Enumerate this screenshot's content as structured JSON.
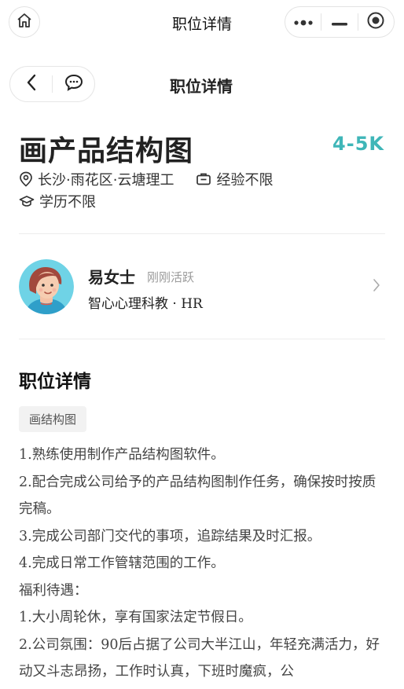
{
  "window": {
    "title": "职位详情"
  },
  "page": {
    "title": "职位详情"
  },
  "job": {
    "title": "画产品结构图",
    "salary": "4-5K",
    "location": "长沙·雨花区·云塘理工",
    "experience": "经验不限",
    "education": "学历不限"
  },
  "recruiter": {
    "name": "易女士",
    "status": "刚刚活跃",
    "company": "智心心理科教 · HR"
  },
  "details": {
    "section_title": "职位详情",
    "tag": "画结构图",
    "lines": [
      "1.熟练使用制作产品结构图软件。",
      "2.配合完成公司给予的产品结构图制作任务，确保按时按质完稿。",
      "3.完成公司部门交代的事项，追踪结果及时汇报。",
      "4.完成日常工作管辖范围的工作。",
      "福利待遇：",
      "1.大小周轮休，享有国家法定节假日。",
      "2.公司氛围：90后占据了公司大半江山，年轻充满活力，好动又斗志昂扬，工作时认真，下班时魔疯，公"
    ]
  },
  "colors": {
    "salary": "#3fb6b8",
    "avatar_bg": "#6fd3e6",
    "hair": "#a2493d"
  },
  "icons": {
    "home": "home-icon",
    "more": "more-dots-icon",
    "minimize": "minimize-icon",
    "close": "record-circle-icon",
    "back": "chevron-left-icon",
    "chat": "chat-bubble-icon",
    "location": "location-pin-icon",
    "experience": "briefcase-icon",
    "education": "graduation-cap-icon",
    "arrow": "chevron-right-icon"
  }
}
